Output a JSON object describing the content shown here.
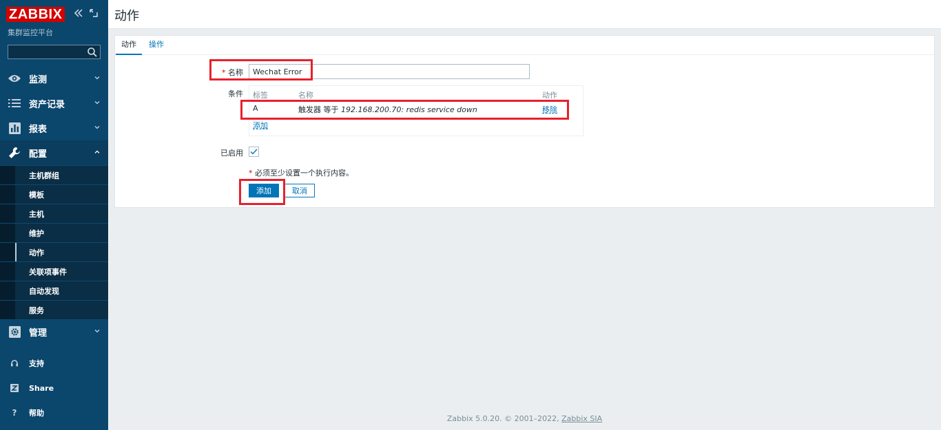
{
  "sidebar": {
    "logo": "ZABBIX",
    "subtitle": "集群监控平台",
    "search_value": "",
    "menu": [
      {
        "label": "监测",
        "icon": "eye-icon",
        "expanded": false
      },
      {
        "label": "资产记录",
        "icon": "list-icon",
        "expanded": false
      },
      {
        "label": "报表",
        "icon": "bar-chart-icon",
        "expanded": false
      },
      {
        "label": "配置",
        "icon": "wrench-icon",
        "expanded": true
      }
    ],
    "config_submenu": [
      "主机群组",
      "模板",
      "主机",
      "维护",
      "动作",
      "关联项事件",
      "自动发现",
      "服务"
    ],
    "admin": {
      "label": "管理",
      "icon": "gear-icon"
    },
    "secondary": [
      {
        "label": "支持",
        "icon": "headset-icon"
      },
      {
        "label": "Share",
        "icon": "share-icon"
      },
      {
        "label": "帮助",
        "icon": "help-icon"
      }
    ]
  },
  "header": {
    "title": "动作"
  },
  "tabs": [
    {
      "label": "动作",
      "active": true
    },
    {
      "label": "操作",
      "active": false
    }
  ],
  "form": {
    "name_label": "名称",
    "name_required_mark": "*",
    "name_value": "Wechat Error",
    "conditions_label": "条件",
    "conditions": {
      "headers": {
        "tag": "标签",
        "name": "名称",
        "action": "动作"
      },
      "rows": [
        {
          "tag": "A",
          "name_prefix": "触发器 等于 ",
          "name_value": "192.168.200.70: redis service down",
          "action": "移除"
        }
      ],
      "add_link": "添加"
    },
    "enabled_label": "已启用",
    "enabled": true,
    "hint_mark": "*",
    "hint": "必须至少设置一个执行内容。",
    "add_button": "添加",
    "cancel_button": "取消"
  },
  "footer": {
    "text": "Zabbix 5.0.20. © 2001–2022, ",
    "link": "Zabbix SIA"
  },
  "colors": {
    "sidebar": "#0b466c",
    "accent": "#0275b8",
    "highlight": "#e8202c",
    "logo": "#d40000"
  }
}
